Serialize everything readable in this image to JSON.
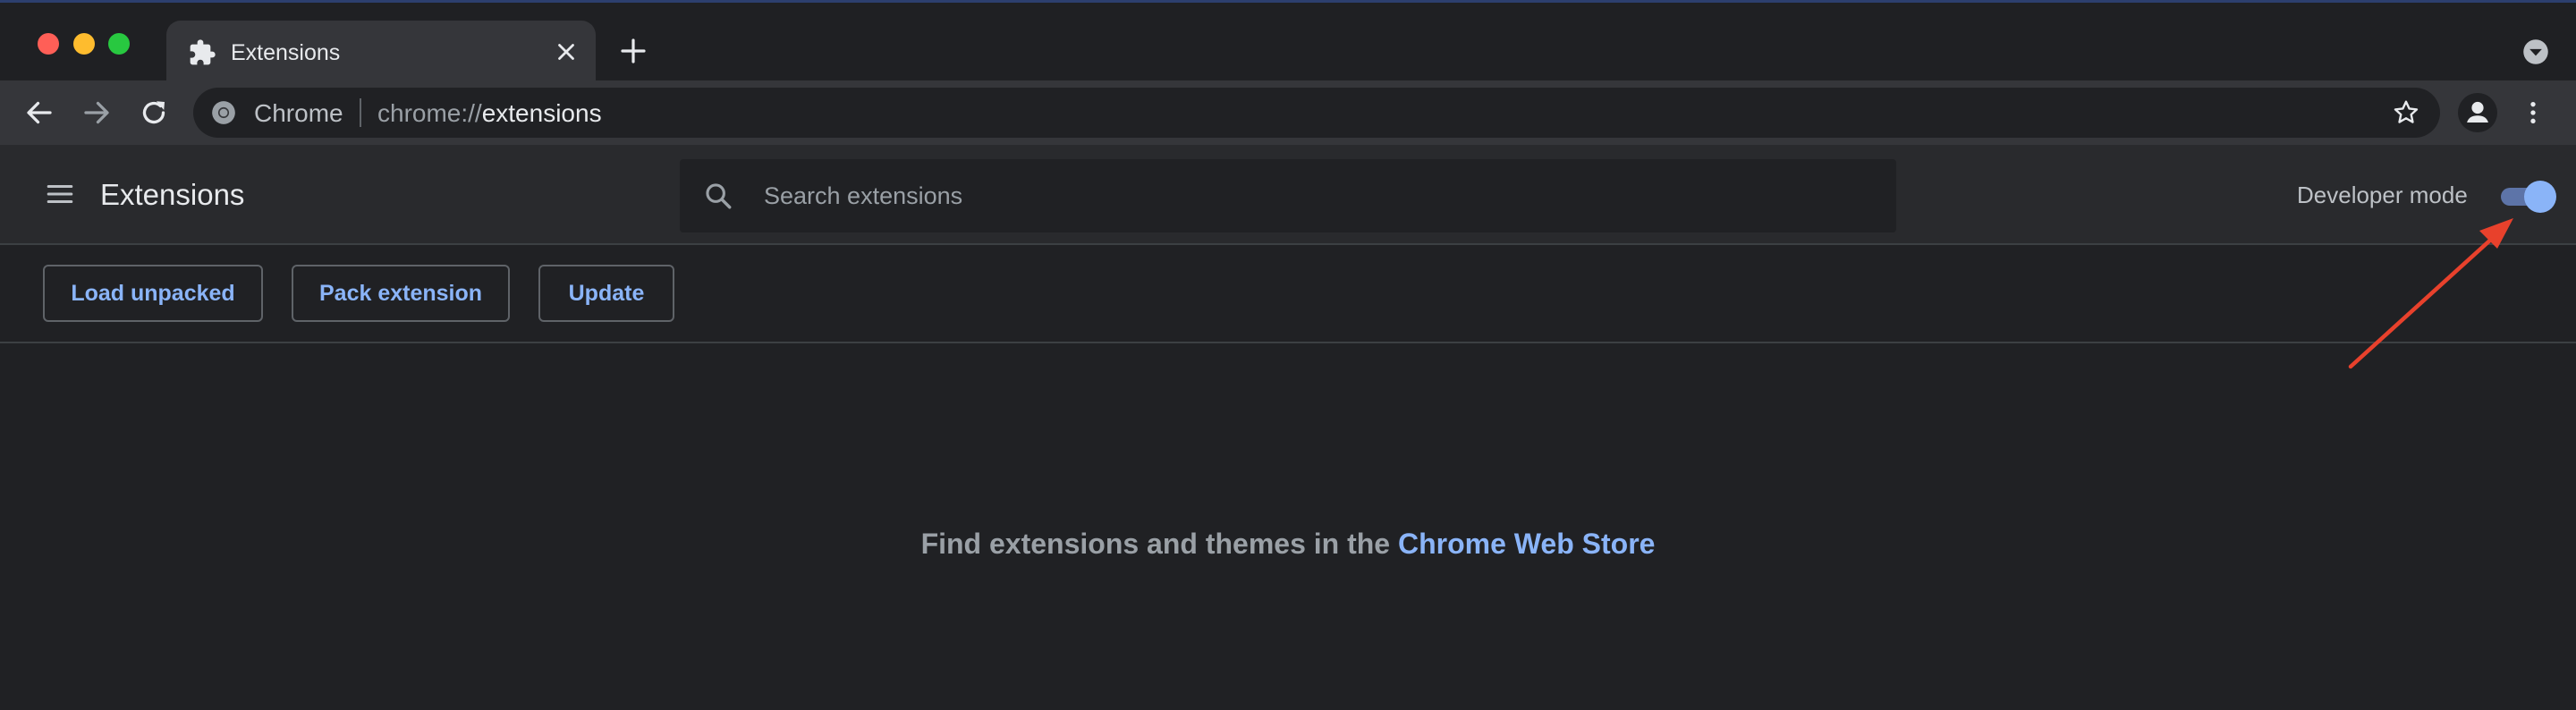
{
  "browser": {
    "tab": {
      "title": "Extensions",
      "icon": "puzzle-icon"
    },
    "omnibox": {
      "chip_label": "Chrome",
      "url_scheme": "chrome://",
      "url_host": "extensions"
    }
  },
  "extensions_page": {
    "title": "Extensions",
    "search": {
      "placeholder": "Search extensions",
      "value": ""
    },
    "developer_mode": {
      "label": "Developer mode",
      "enabled": true
    },
    "dev_buttons": {
      "load_unpacked": "Load unpacked",
      "pack_extension": "Pack extension",
      "update": "Update"
    },
    "empty_state": {
      "text": "Find extensions and themes in the",
      "link_text": "Chrome Web Store"
    }
  },
  "colors": {
    "accent": "#8ab4f8",
    "annotation_arrow": "#e8412c"
  }
}
